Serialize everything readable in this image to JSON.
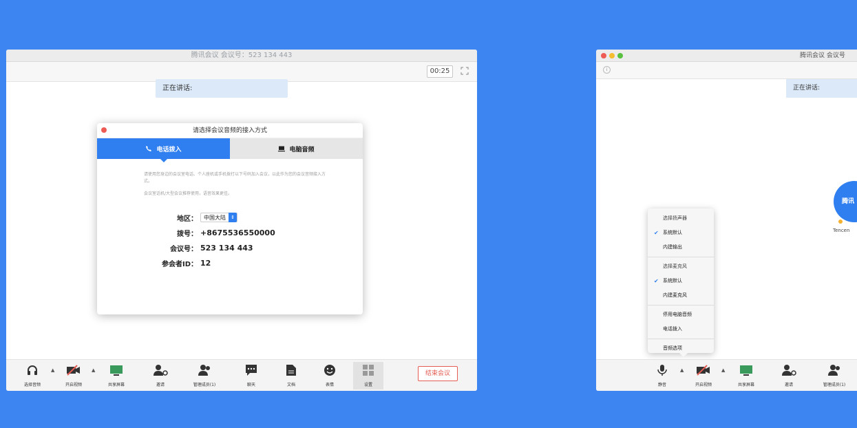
{
  "left_window": {
    "title": "腾讯会议 会议号：523 134 443",
    "timer": "00:25",
    "speaking_label": "正在讲话:",
    "dialog": {
      "title": "请选择会议音频的接入方式",
      "tab_phone": "电话拨入",
      "tab_computer": "电脑音频",
      "description": "请使用您身边的会议室电话、个人座机或手机拨打以下号码加入会议，以此作为您的会议音频接入方式。",
      "note": "会议室话机/大型会议推荐使用，语音效果更佳。",
      "region_label": "地区：",
      "region_value": "中国大陆",
      "dial_label": "拨号：",
      "dial_value": "+8675536550000",
      "meeting_label": "会议号：",
      "meeting_value": "523 134 443",
      "participant_label": "参会者ID：",
      "participant_value": "12"
    },
    "toolbar": {
      "audio": "选择音频",
      "video": "开启视频",
      "share": "共享屏幕",
      "invite": "邀请",
      "members": "管理成员(1)",
      "chat": "聊天",
      "docs": "文档",
      "emoji": "表情",
      "settings": "设置",
      "end": "结束会议"
    }
  },
  "right_window": {
    "title": "腾讯会议 会议号",
    "speaking_label": "正在讲话:",
    "avatar_text": "腾讯",
    "avatar_name": "Tencen",
    "menu": {
      "speaker_header": "选择扬声器",
      "speaker_default": "系统默认",
      "speaker_builtin": "内建输出",
      "mic_header": "选择麦克风",
      "mic_default": "系统默认",
      "mic_builtin": "内建麦克风",
      "disable_audio": "停用电脑音频",
      "phone_dial": "电话拨入",
      "audio_options": "音频选项"
    },
    "toolbar": {
      "mute": "静音",
      "video": "开启视频",
      "share": "共享屏幕",
      "invite": "邀请",
      "members": "管理成员(1)"
    }
  },
  "colors": {
    "background": "#3d86f2",
    "accent": "#2f7ff0",
    "end_button": "#e45c52"
  }
}
